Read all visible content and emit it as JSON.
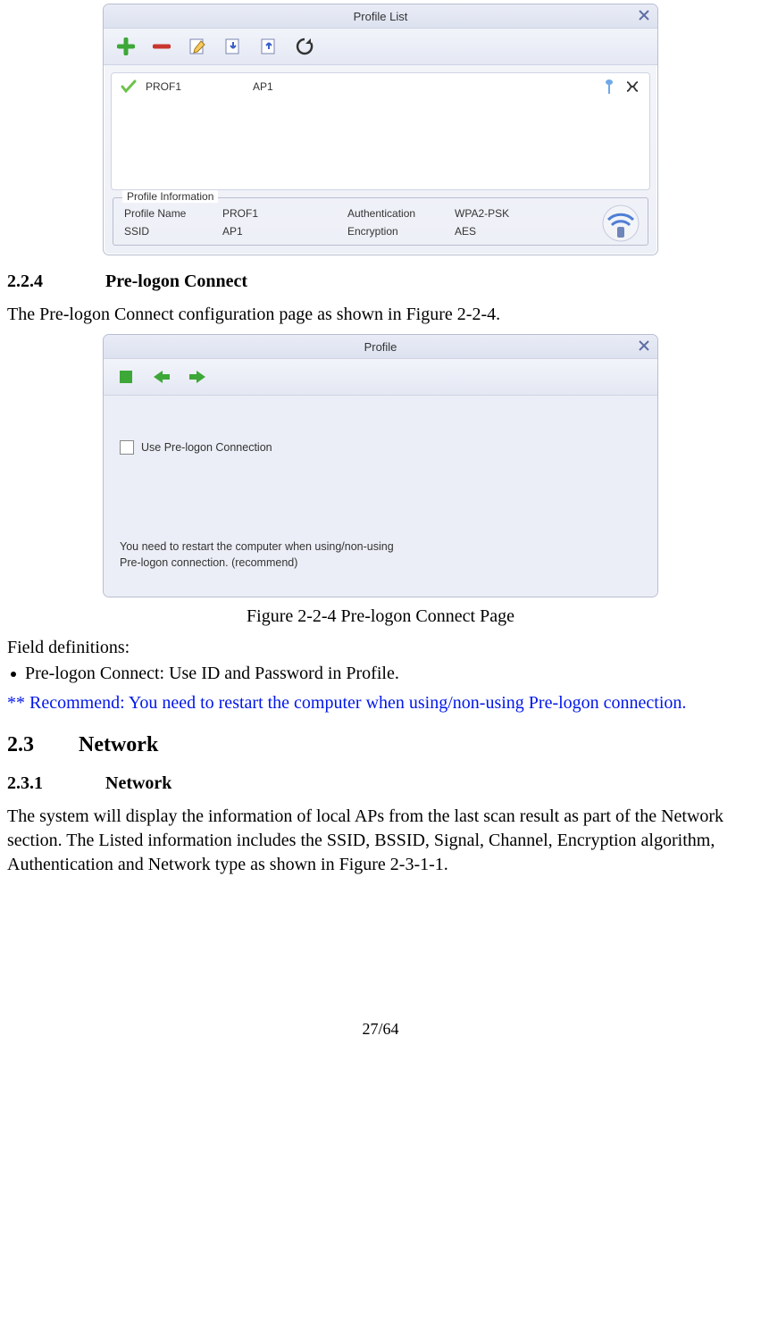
{
  "window1": {
    "title": "Profile List",
    "toolbar_icons": [
      "add-icon",
      "remove-icon",
      "edit-icon",
      "import-icon",
      "export-icon",
      "refresh-icon"
    ],
    "row": {
      "name": "PROF1",
      "ssid": "AP1"
    },
    "group_legend": "Profile Information",
    "info": {
      "profile_name_label": "Profile Name",
      "profile_name_value": "PROF1",
      "auth_label": "Authentication",
      "auth_value": "WPA2-PSK",
      "ssid_label": "SSID",
      "ssid_value": "AP1",
      "enc_label": "Encryption",
      "enc_value": "AES"
    }
  },
  "section_224_num": "2.2.4",
  "section_224_title": "Pre-logon Connect",
  "para1": "The Pre-logon Connect configuration page as shown in Figure 2-2-4.",
  "window2": {
    "title": "Profile",
    "checkbox_label": "Use Pre-logon Connection",
    "hint_line1": "You need to restart the computer when using/non-using",
    "hint_line2": "Pre-logon connection. (recommend)"
  },
  "caption": "Figure 2-2-4 Pre-logon Connect Page",
  "field_def_heading": "Field definitions:",
  "bullet1": "Pre-logon Connect: Use ID and Password in Profile.",
  "recommend": "** Recommend: You need to restart the computer when using/non-using Pre-logon connection.",
  "section_23_num": "2.3",
  "section_23_title": "Network",
  "section_231_num": "2.3.1",
  "section_231_title": "Network",
  "para2": "The system will display the information of local APs from the last scan result as part of the Network section. The Listed information includes the SSID, BSSID, Signal, Channel, Encryption algorithm, Authentication and Network type as shown in Figure 2-3-1-1.",
  "pagenum": "27/64"
}
